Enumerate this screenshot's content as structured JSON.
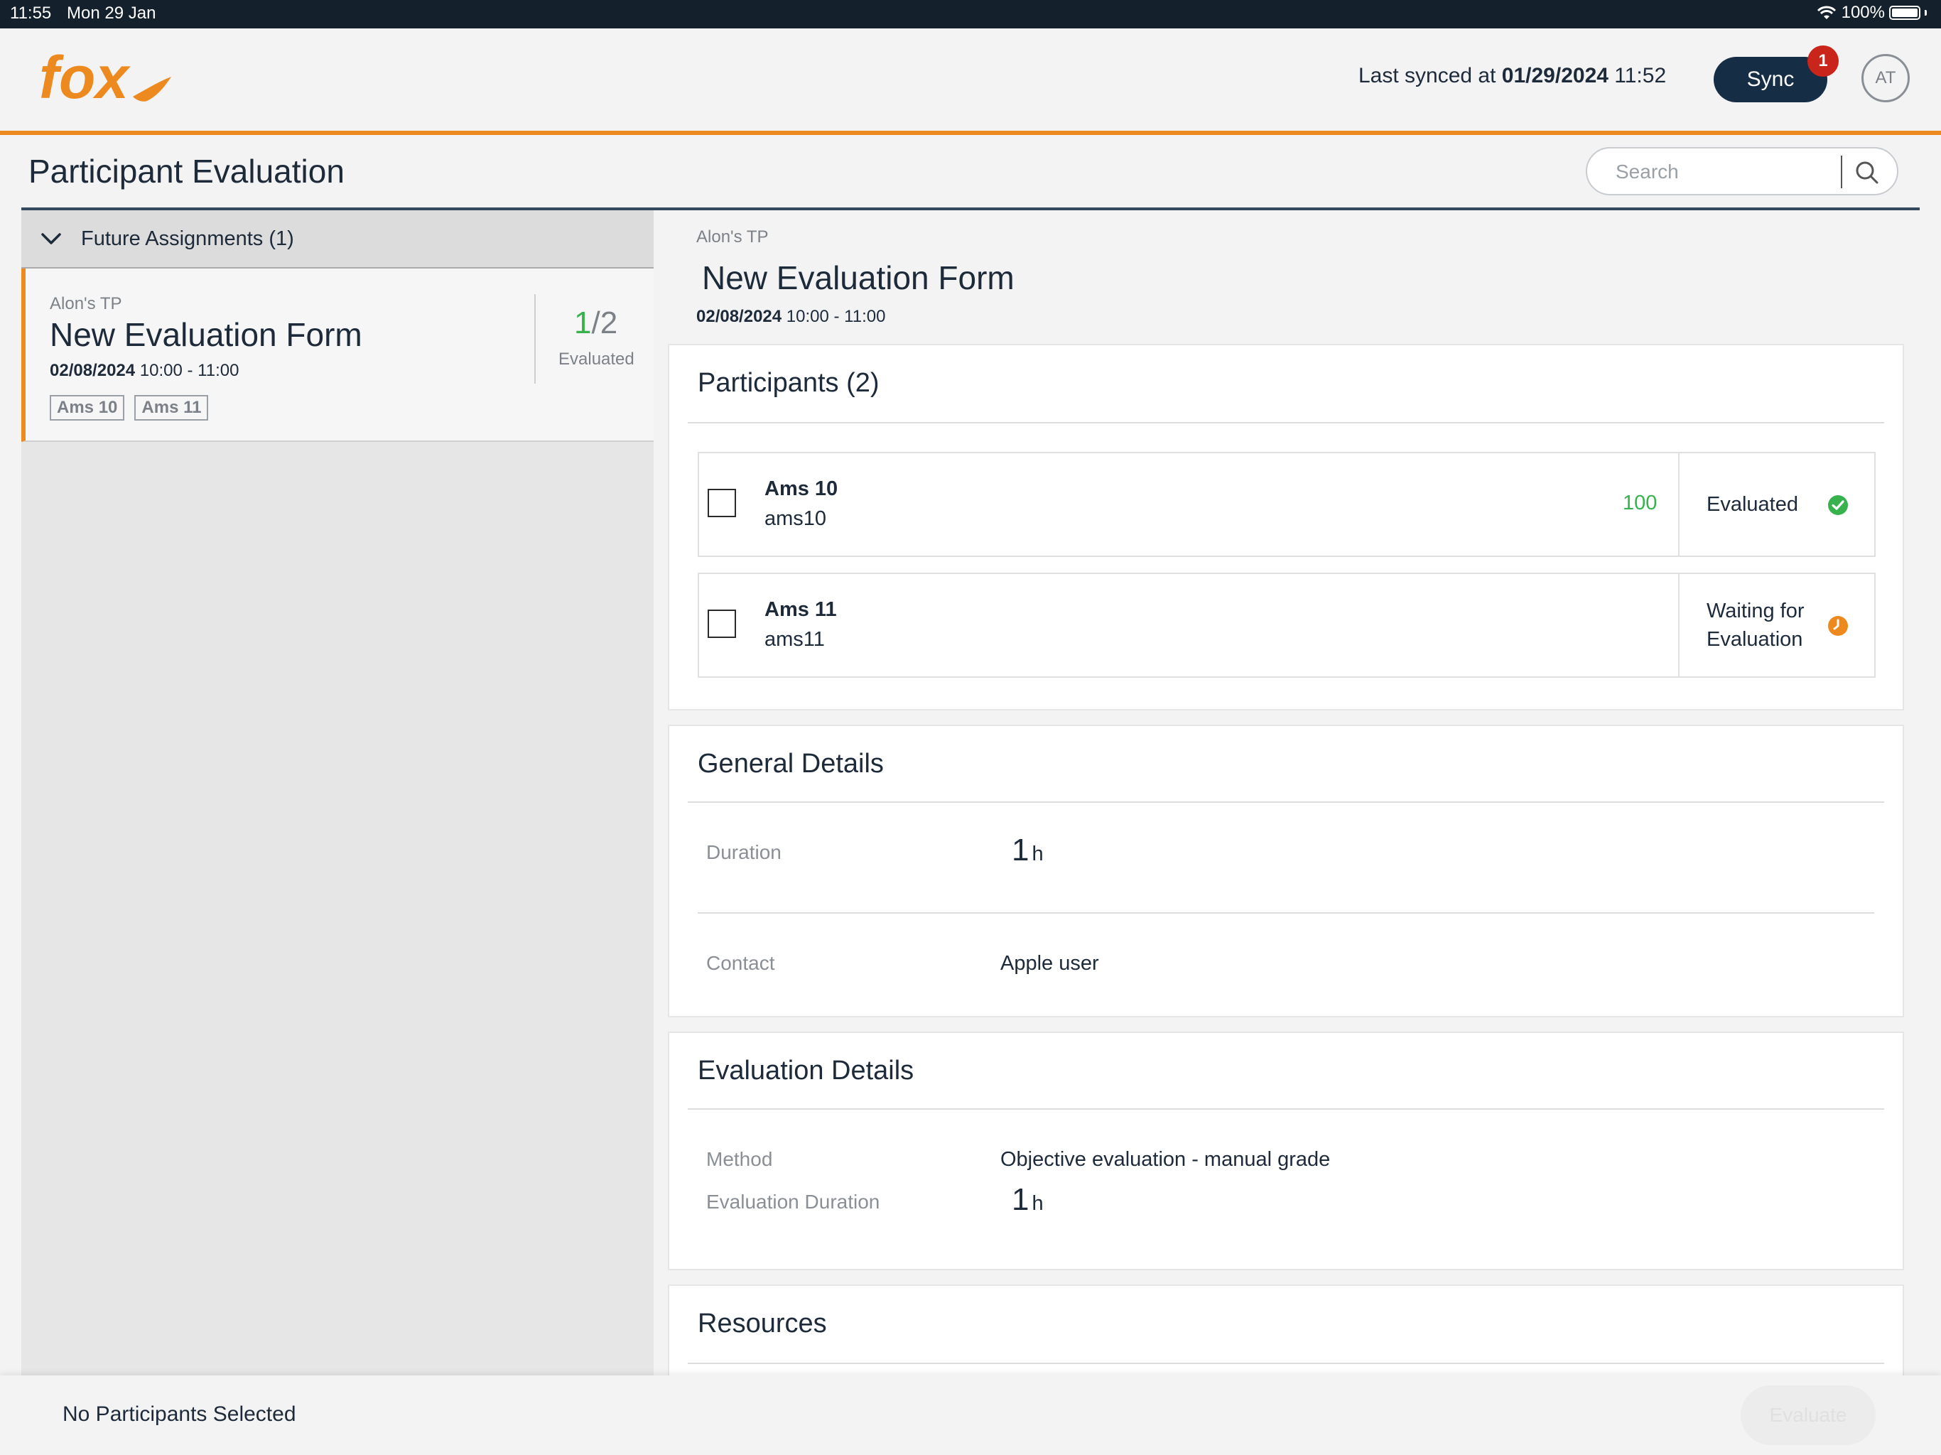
{
  "status_bar": {
    "time": "11:55",
    "date": "Mon 29 Jan",
    "battery": "100%"
  },
  "header": {
    "logo_text": "fox",
    "sync_prefix": "Last synced at ",
    "sync_date": "01/29/2024",
    "sync_time": " 11:52",
    "sync_button": "Sync",
    "sync_badge": "1",
    "avatar": "AT",
    "accent_color": "#ed8a1f"
  },
  "page": {
    "title": "Participant Evaluation",
    "search_placeholder": "Search"
  },
  "left_panel": {
    "group_label": "Future Assignments (1)",
    "card": {
      "tp": "Alon's TP",
      "name": "New Evaluation Form",
      "date": "02/08/2024",
      "time": " 10:00 - 11:00",
      "tags": [
        "Ams 10",
        "Ams 11"
      ],
      "evaluated_num": "1",
      "evaluated_total": "/2",
      "evaluated_label": "Evaluated"
    }
  },
  "detail": {
    "tp": "Alon's TP",
    "title": "New Evaluation Form",
    "date": "02/08/2024",
    "time": " 10:00 - 11:00",
    "participants": {
      "title": "Participants (2)",
      "rows": [
        {
          "name": "Ams 10",
          "username": "ams10",
          "score": "100",
          "status": "Evaluated",
          "status_icon": "check-circle-icon"
        },
        {
          "name": "Ams 11",
          "username": "ams11",
          "score": "",
          "status_line1": "Waiting for",
          "status_line2": "Evaluation",
          "status_icon": "clock-icon"
        }
      ]
    },
    "general": {
      "title": "General Details",
      "duration_label": "Duration",
      "duration_value": "1",
      "duration_unit": "h",
      "contact_label": "Contact",
      "contact_value": "Apple user"
    },
    "evaluation": {
      "title": "Evaluation Details",
      "method_label": "Method",
      "method_value": "Objective evaluation - manual grade",
      "duration_label": "Evaluation Duration",
      "duration_value": "1",
      "duration_unit": "h"
    },
    "resources": {
      "title": "Resources"
    }
  },
  "bottom_bar": {
    "message": "No Participants Selected",
    "evaluate_button": "Evaluate"
  }
}
